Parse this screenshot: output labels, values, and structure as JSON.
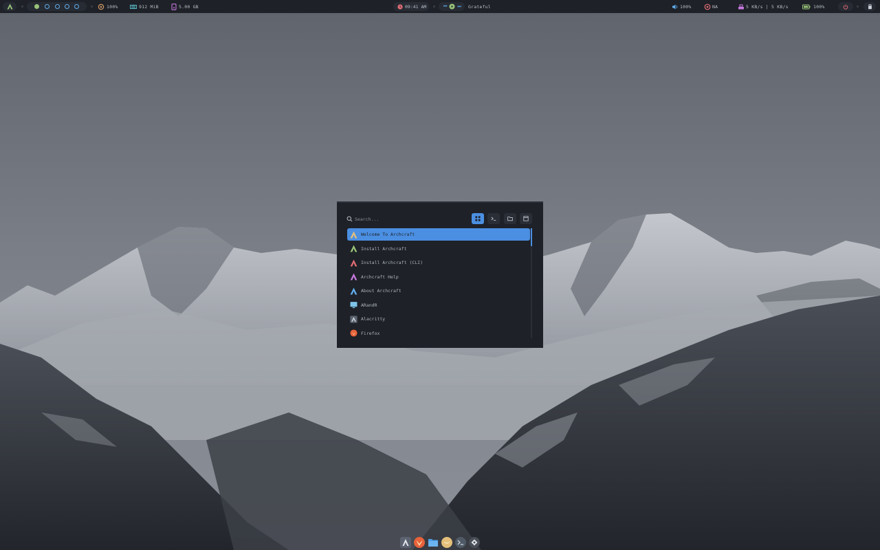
{
  "topbar": {
    "cpu": "100%",
    "memory": "912 MiB",
    "disk": "5.00 GB",
    "time": "09:41 AM",
    "song": "Grateful",
    "volume": "100%",
    "network_status": "NA",
    "network_speed": "5 KB/s | 5 KB/s",
    "battery": "100%",
    "workspaces": [
      {
        "id": 1,
        "active": true
      },
      {
        "id": 2,
        "active": false
      },
      {
        "id": 3,
        "active": false
      },
      {
        "id": 4,
        "active": false
      },
      {
        "id": 5,
        "active": false
      }
    ]
  },
  "launcher": {
    "search_placeholder": "Search...",
    "modes": [
      "apps-mode",
      "run-mode",
      "files-mode",
      "windows-mode"
    ],
    "active_mode": "apps-mode",
    "items": [
      {
        "label": "Welcome To Archcraft",
        "icon": "archcraft-logo-icon",
        "selected": true
      },
      {
        "label": "Install Archcraft",
        "icon": "archcraft-logo-icon",
        "selected": false
      },
      {
        "label": "Install Archcraft (CLI)",
        "icon": "archcraft-logo-icon",
        "selected": false
      },
      {
        "label": "Archcraft Help",
        "icon": "archcraft-logo-icon",
        "selected": false
      },
      {
        "label": "About Archcraft",
        "icon": "archcraft-logo-icon",
        "selected": false
      },
      {
        "label": "ARandR",
        "icon": "monitor-icon",
        "selected": false
      },
      {
        "label": "Alacritty",
        "icon": "alacritty-icon",
        "selected": false
      },
      {
        "label": "Firefox",
        "icon": "firefox-icon",
        "selected": false
      }
    ]
  },
  "dock": {
    "items": [
      "archcraft-icon",
      "firefox-icon",
      "files-icon",
      "music-icon",
      "terminal-icon",
      "settings-icon"
    ]
  },
  "colors": {
    "bar_bg": "#1e2127",
    "accent": "#4b8fe2",
    "green": "#98c379",
    "red": "#e06c75",
    "yellow": "#d19a66",
    "purple": "#c678dd",
    "cyan": "#56b6c2"
  }
}
